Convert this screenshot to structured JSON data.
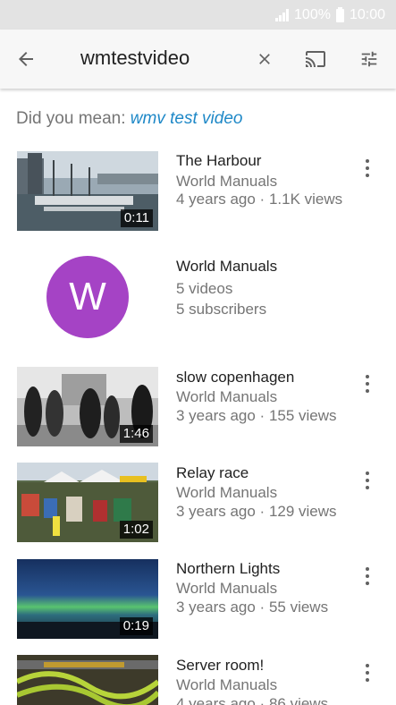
{
  "status_bar": {
    "battery": "100%",
    "time": "10:00"
  },
  "search_bar": {
    "query": "wmtestvideo"
  },
  "suggestion": {
    "prefix": "Did you mean: ",
    "link": "wmv test video"
  },
  "results": [
    {
      "title": "The Harbour",
      "channel": "World Manuals",
      "meta": "4 years ago · 1.1K views",
      "duration": "0:11"
    },
    {
      "channel_name": "World Manuals",
      "avatar_letter": "W",
      "videos": "5 videos",
      "subscribers": "5 subscribers",
      "avatar_color": "#a543c5"
    },
    {
      "title": "slow copenhagen",
      "channel": "World Manuals",
      "meta": "3 years ago · 155 views",
      "duration": "1:46"
    },
    {
      "title": "Relay race",
      "channel": "World Manuals",
      "meta": "3 years ago · 129 views",
      "duration": "1:02"
    },
    {
      "title": "Northern Lights",
      "channel": "World Manuals",
      "meta": "3 years ago · 55 views",
      "duration": "0:19"
    },
    {
      "title": "Server room!",
      "channel": "World Manuals",
      "meta": "4 years ago · 86 views"
    }
  ],
  "colors": {
    "link": "#1e88c7",
    "status_bar": "#e3e3e3"
  },
  "icons": [
    "back-arrow-icon",
    "clear-icon",
    "cast-icon",
    "filter-icon",
    "more-vert-icon",
    "signal-icon",
    "battery-icon"
  ]
}
